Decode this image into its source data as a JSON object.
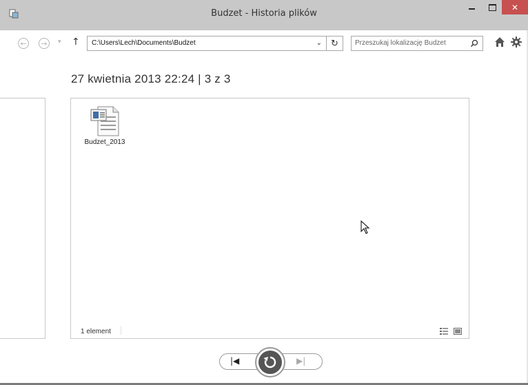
{
  "window": {
    "title": "Budzet - Historia plików",
    "minimize_glyph": "",
    "close_glyph": "✕"
  },
  "nav": {
    "back_glyph": "←",
    "forward_glyph": "→",
    "dropdown_glyph": "▾",
    "up_glyph": "↑",
    "address": "C:\\Users\\Lech\\Documents\\Budzet",
    "address_dropdown_glyph": "⌄",
    "refresh_glyph": "↻",
    "search_placeholder": "Przeszukaj lokalizację Budzet",
    "search_glyph": "⚲"
  },
  "snapshot": {
    "heading": "27 kwietnia 2013 22:24   |   3 z 3"
  },
  "files": [
    {
      "name": "Budzet_2013",
      "icon": "document-icon"
    }
  ],
  "status": {
    "item_count": "1 element"
  },
  "controls": {
    "previous_glyph": "|◀",
    "next_glyph": "▶|",
    "restore_icon": "restore-icon"
  }
}
